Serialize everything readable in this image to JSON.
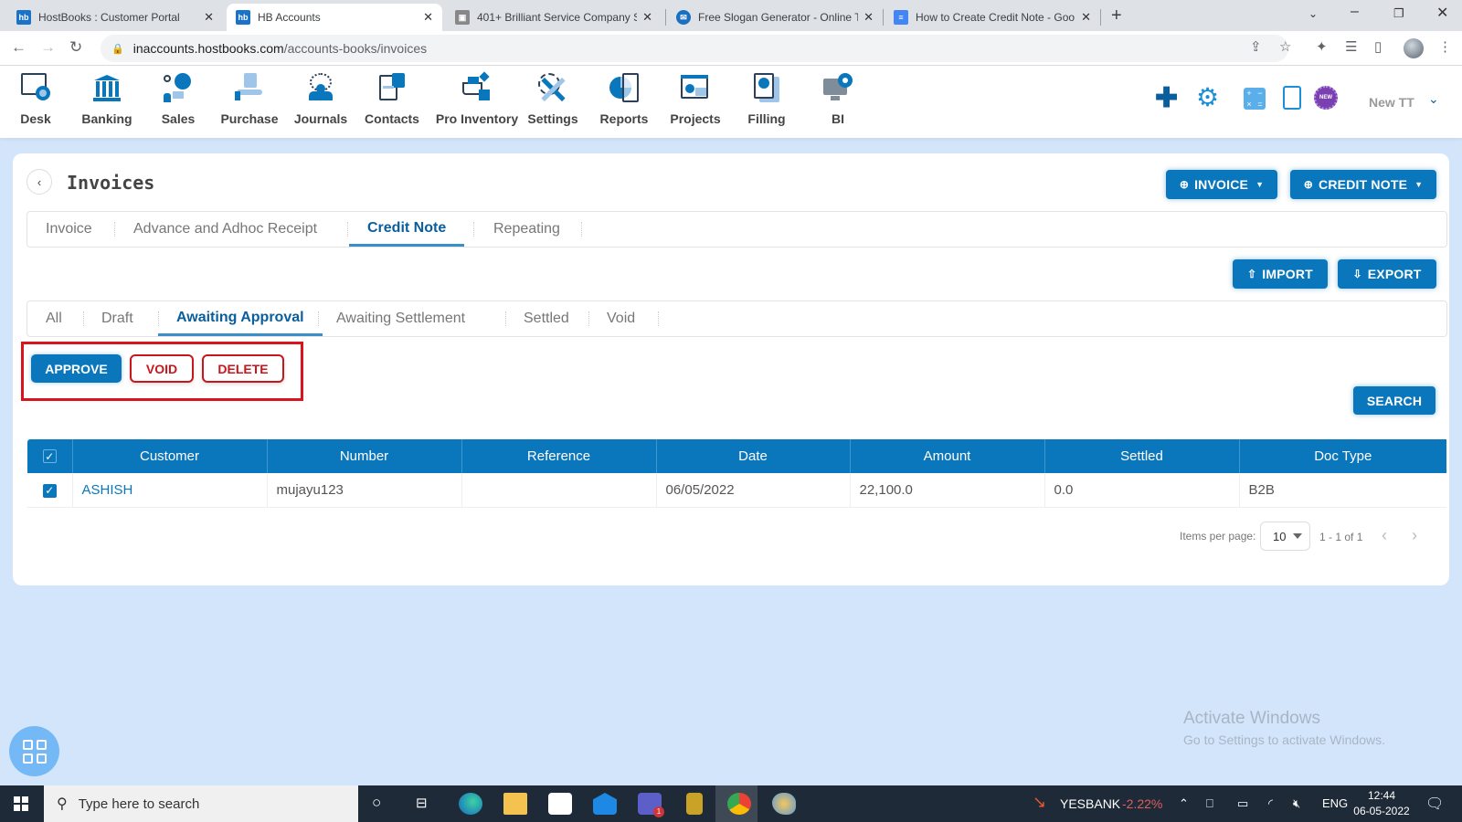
{
  "browser": {
    "tabs": [
      {
        "title": "HostBooks : Customer Portal",
        "icon": "hostbooks-icon",
        "active": false
      },
      {
        "title": "HB Accounts",
        "icon": "hostbooks-icon",
        "active": true
      },
      {
        "title": "401+ Brilliant Service Company S",
        "icon": "robot-icon",
        "active": false
      },
      {
        "title": "Free Slogan Generator - Online T",
        "icon": "slogan-icon",
        "active": false
      },
      {
        "title": "How to Create Credit Note - Goo",
        "icon": "google-docs-icon",
        "active": false
      }
    ],
    "favicon_text": "hb",
    "url_host": "inaccounts.hostbooks.com",
    "url_path": "/accounts-books/invoices"
  },
  "app_nav": {
    "items": [
      {
        "label": "Desk",
        "icon": "desk-icon"
      },
      {
        "label": "Banking",
        "icon": "bank-icon"
      },
      {
        "label": "Sales",
        "icon": "sales-icon"
      },
      {
        "label": "Purchase",
        "icon": "purchase-icon"
      },
      {
        "label": "Journals",
        "icon": "journals-icon"
      },
      {
        "label": "Contacts",
        "icon": "contacts-icon"
      },
      {
        "label": "Pro Inventory",
        "icon": "inventory-icon"
      },
      {
        "label": "Settings",
        "icon": "settings-tools-icon"
      },
      {
        "label": "Reports",
        "icon": "reports-icon"
      },
      {
        "label": "Projects",
        "icon": "projects-icon"
      },
      {
        "label": "Filling",
        "icon": "filling-icon"
      },
      {
        "label": "BI",
        "icon": "bi-icon"
      }
    ],
    "quick_actions": [
      "plus-icon",
      "gear-icon",
      "calculator-icon",
      "clipboard-icon",
      "new-badge-icon"
    ],
    "new_badge_text": "NEW",
    "user_name": "New TT"
  },
  "page": {
    "title": "Invoices",
    "invoice_button": "INVOICE",
    "credit_note_button": "CREDIT NOTE",
    "import_button": "IMPORT",
    "export_button": "EXPORT",
    "search_button": "SEARCH",
    "main_tabs": [
      {
        "label": "Invoice",
        "active": false
      },
      {
        "label": "Advance and Adhoc Receipt",
        "active": false
      },
      {
        "label": "Credit Note",
        "active": true
      },
      {
        "label": "Repeating",
        "active": false
      }
    ],
    "status_tabs": [
      {
        "label": "All",
        "active": false
      },
      {
        "label": "Draft",
        "active": false
      },
      {
        "label": "Awaiting Approval",
        "active": true
      },
      {
        "label": "Awaiting Settlement",
        "active": false
      },
      {
        "label": "Settled",
        "active": false
      },
      {
        "label": "Void",
        "active": false
      }
    ],
    "actions": {
      "approve": "APPROVE",
      "void": "VOID",
      "delete": "DELETE"
    }
  },
  "table": {
    "columns": [
      "Customer",
      "Number",
      "Reference",
      "Date",
      "Amount",
      "Settled",
      "Doc Type"
    ],
    "rows": [
      {
        "checked": true,
        "customer": "ASHISH",
        "number": "mujayu123",
        "reference": "",
        "date": "06/05/2022",
        "amount": "22,100.0",
        "settled": "0.0",
        "doc_type": "B2B"
      }
    ],
    "header_checked": true
  },
  "pagination": {
    "items_per_page_label": "Items per page:",
    "items_per_page": "10",
    "range": "1 - 1 of 1"
  },
  "watermark": {
    "line1": "Activate Windows",
    "line2": "Go to Settings to activate Windows."
  },
  "taskbar": {
    "search_placeholder": "Type here to search",
    "stock_name": "YESBANK",
    "stock_change": "-2.22%",
    "language": "ENG",
    "time": "12:44",
    "date": "06-05-2022",
    "teams_badge": "1"
  },
  "colors": {
    "primary": "#0a77bd",
    "danger": "#c8161d",
    "page_bg": "#d3e5fb",
    "stock_negative": "#e05d5d"
  }
}
